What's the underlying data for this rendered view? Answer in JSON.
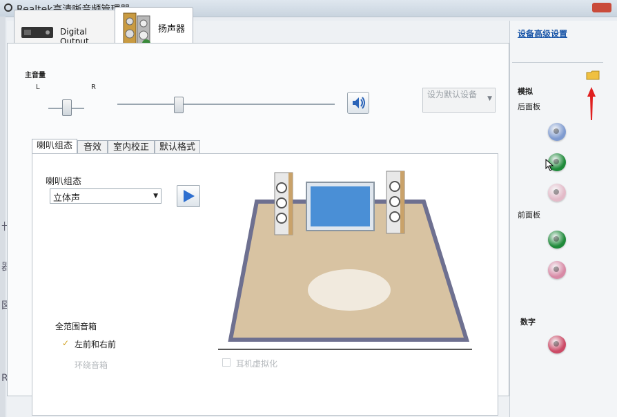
{
  "window": {
    "title": "Realtek高清晰音频管理器"
  },
  "left_edge_glyphs": [
    "卄",
    "器",
    "図",
    "R)"
  ],
  "device_tabs": [
    {
      "label": "Digital Output"
    },
    {
      "label": "扬声器"
    }
  ],
  "master_volume": {
    "label": "主音量",
    "left": "L",
    "right": "R",
    "balance_level": 0.5,
    "volume_level": 0.28
  },
  "default_device_button": {
    "label": "设为默认设备"
  },
  "sub_tabs": [
    {
      "label": "喇叭组态"
    },
    {
      "label": "音效"
    },
    {
      "label": "室内校正"
    },
    {
      "label": "默认格式"
    }
  ],
  "speaker_config": {
    "label": "喇叭组态",
    "selected": "立体声"
  },
  "full_range": {
    "label": "全范围音箱",
    "front": {
      "label": "左前和右前",
      "checked": true
    },
    "surround": {
      "label": "环绕音箱",
      "checked": false,
      "disabled": true
    }
  },
  "headphone_virtualization": {
    "label": "耳机虚拟化",
    "checked": false,
    "disabled": true
  },
  "right_panel": {
    "advanced_link": "设备高级设置",
    "analog_label": "模拟",
    "back_panel_label": "后面板",
    "front_panel_label": "前面板",
    "digital_label": "数字",
    "jack_colors": {
      "back_blue": "#7f9bd0",
      "back_green": "#1f8a3a",
      "back_pink": "#e3bac8",
      "front_green": "#1f8a3a",
      "front_pink": "#d88aa6",
      "digital": "#cc4a66"
    }
  }
}
